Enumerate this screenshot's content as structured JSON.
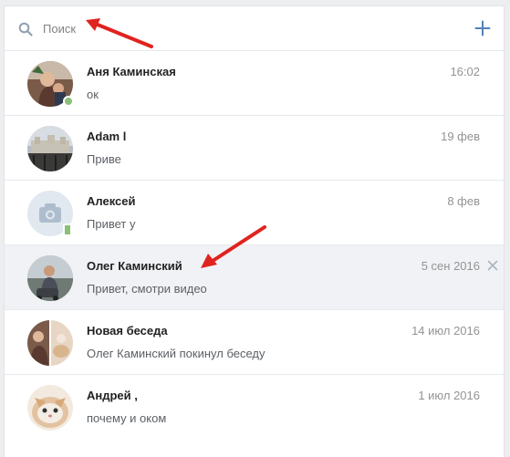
{
  "search": {
    "placeholder": "Поиск",
    "value": ""
  },
  "dialogs": [
    {
      "name": "Аня Каминская",
      "preview": "ок",
      "time": "16:02",
      "online": "dot",
      "selected": false
    },
    {
      "name": "Adam l",
      "preview": "Приве",
      "time": "19 фев",
      "online": "",
      "selected": false
    },
    {
      "name": "Алексей",
      "preview": "Привет у",
      "time": "8 фев",
      "online": "mobile",
      "selected": false
    },
    {
      "name": "Олег Каминский",
      "preview": "Привет, смотри видео",
      "time": "5 сен 2016",
      "online": "",
      "selected": true
    },
    {
      "name": "Новая беседа",
      "preview": "Олег Каминский покинул беседу",
      "time": "14 июл 2016",
      "online": "",
      "selected": false
    },
    {
      "name": "Андрей ,",
      "preview": "почему и оком",
      "time": "1 июл 2016",
      "online": "",
      "selected": false
    }
  ],
  "colors": {
    "accent": "#5181b8",
    "online": "#8ac176",
    "annotation_arrow": "#e0231f",
    "selected_row": "#f0f2f5"
  },
  "icons": [
    "search-icon",
    "plus-icon",
    "close-icon",
    "camera-icon"
  ]
}
